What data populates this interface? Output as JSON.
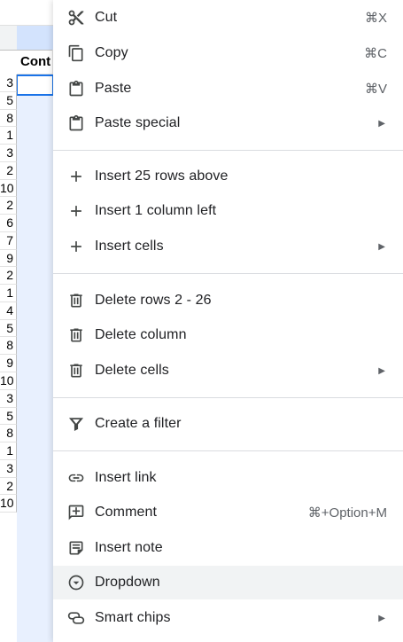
{
  "sheet": {
    "column_header_text": "Cont",
    "row_numbers": [
      "3",
      "5",
      "8",
      "1",
      "3",
      "2",
      "10",
      "2",
      "6",
      "7",
      "9",
      "2",
      "1",
      "4",
      "5",
      "8",
      "9",
      "10",
      "3",
      "5",
      "8",
      "1",
      "3",
      "2",
      "10"
    ]
  },
  "menu": {
    "cut": {
      "label": "Cut",
      "shortcut": "⌘X"
    },
    "copy": {
      "label": "Copy",
      "shortcut": "⌘C"
    },
    "paste": {
      "label": "Paste",
      "shortcut": "⌘V"
    },
    "paste_special": {
      "label": "Paste special",
      "arrow": "▶"
    },
    "insert_rows": {
      "label": "Insert 25 rows above"
    },
    "insert_column": {
      "label": "Insert 1 column left"
    },
    "insert_cells": {
      "label": "Insert cells",
      "arrow": "▶"
    },
    "delete_rows": {
      "label": "Delete rows 2 - 26"
    },
    "delete_column": {
      "label": "Delete column"
    },
    "delete_cells": {
      "label": "Delete cells",
      "arrow": "▶"
    },
    "create_filter": {
      "label": "Create a filter"
    },
    "insert_link": {
      "label": "Insert link"
    },
    "comment": {
      "label": "Comment",
      "shortcut": "⌘+Option+M"
    },
    "insert_note": {
      "label": "Insert note"
    },
    "dropdown": {
      "label": "Dropdown"
    },
    "smart_chips": {
      "label": "Smart chips",
      "arrow": "▶"
    }
  },
  "colors": {
    "selection_fill": "#e8f0fe",
    "active_cell_border": "#1a73e8",
    "hover_bg": "#f1f3f4",
    "icon": "#444746"
  },
  "icons": {
    "cut": "scissors-icon",
    "copy": "copy-icon",
    "paste": "clipboard-icon",
    "paste_special": "clipboard-icon",
    "insert": "plus-icon",
    "delete": "trash-icon",
    "filter": "filter-icon",
    "link": "link-icon",
    "comment": "comment-icon",
    "note": "note-icon",
    "dropdown": "dropdown-circle-icon",
    "smart_chips": "chips-icon"
  }
}
